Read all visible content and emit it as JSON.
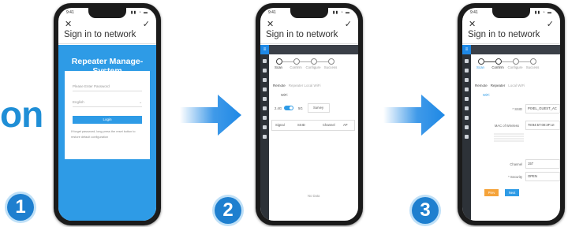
{
  "intro_text": "on",
  "steps": [
    "1",
    "2",
    "3"
  ],
  "phone_common": {
    "title": "Sign in to network",
    "close_glyph": "✕",
    "confirm_glyph": "✓"
  },
  "phone1": {
    "header": "Repeater Manage-System",
    "password_placeholder": "Please Enter Password",
    "language_value": "English",
    "login_label": "Login",
    "note": "If forget password, long press the reset button to restore default configuration"
  },
  "phone2": {
    "steps": [
      "Scan",
      "Confirm",
      "Configure",
      "Success"
    ],
    "tabs": [
      "Remote",
      "Repeater Local WiFi"
    ],
    "wifi_label": "WiFi",
    "band_24": "2.4G",
    "band_5": "5G",
    "survey_label": "Survey",
    "col_signal": "Signal",
    "col_ssid": "SSID",
    "col_channel": "Channel",
    "col_ap": "AP",
    "no_data": "No Data"
  },
  "phone3": {
    "steps": [
      "Scan",
      "Confirm",
      "Configure",
      "Success"
    ],
    "tabs": [
      "Remote",
      "Repeater",
      "Local WiFi"
    ],
    "wifi_label": "WiFi",
    "ssid_label": "* SSID",
    "ssid_value": "PIXEL_GUEST_AC",
    "mac_label": "MAC of Wireless",
    "mac_value": "78:94:57:00:3F:UI",
    "channel_label": "Channel",
    "channel_value": "157",
    "security_label": "* Security",
    "security_value": "OPEN",
    "prev_label": "Prev",
    "next_label": "Next"
  },
  "colors": {
    "brand_blue": "#2e9be6",
    "arrow_blue": "#1e88e5",
    "orange": "#f5a33a"
  }
}
